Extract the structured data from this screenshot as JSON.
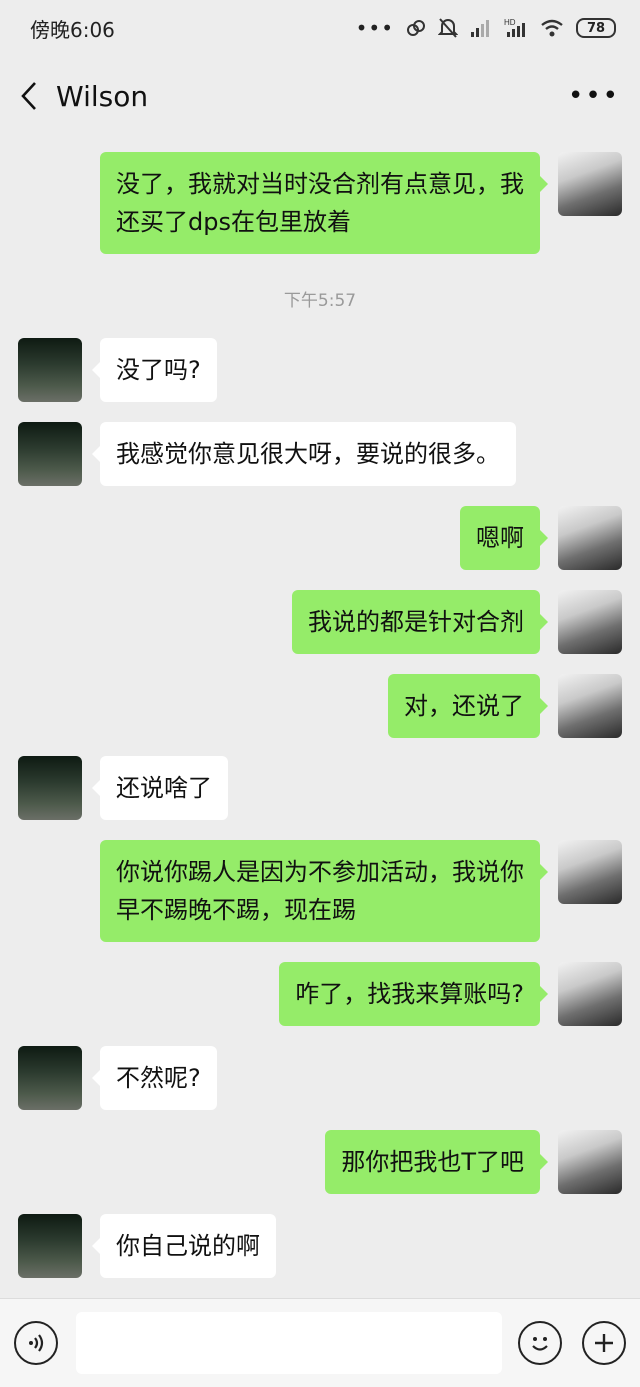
{
  "status_bar": {
    "time": "傍晚6:06",
    "battery": "78"
  },
  "header": {
    "contact_name": "Wilson"
  },
  "timestamp": "下午5:57",
  "messages": [
    {
      "sender": "me",
      "text": "没了，我就对当时没合剂有点意见，我还买了dps在包里放着"
    },
    {
      "sender": "other",
      "text": "没了吗?"
    },
    {
      "sender": "other",
      "text": "我感觉你意见很大呀，要说的很多。"
    },
    {
      "sender": "me",
      "text": "嗯啊"
    },
    {
      "sender": "me",
      "text": "我说的都是针对合剂"
    },
    {
      "sender": "me",
      "text": "对，还说了"
    },
    {
      "sender": "other",
      "text": "还说啥了"
    },
    {
      "sender": "me",
      "text": "你说你踢人是因为不参加活动，我说你早不踢晚不踢，现在踢"
    },
    {
      "sender": "me",
      "text": "咋了，找我来算账吗?"
    },
    {
      "sender": "other",
      "text": "不然呢?"
    },
    {
      "sender": "me",
      "text": "那你把我也T了吧"
    },
    {
      "sender": "other",
      "text": "你自己说的啊"
    }
  ],
  "input": {
    "value": ""
  }
}
